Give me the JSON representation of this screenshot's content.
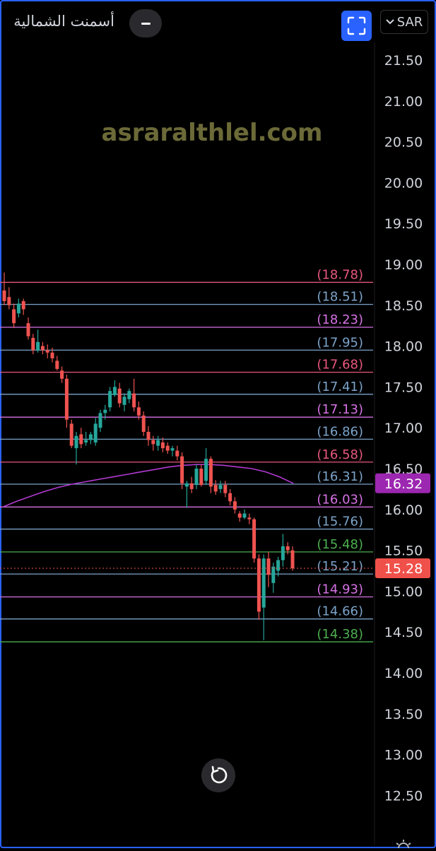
{
  "header": {
    "symbol_name": "أسمنت الشمالية",
    "currency": "SAR"
  },
  "watermark": "asraralthlel.com",
  "colors": {
    "accent": "#2962ff",
    "up_candle": "#26a69a",
    "down_candle": "#ef5350",
    "ma_line": "#b13ad1",
    "last_price_bg": "#f0504a",
    "ma_label_bg": "#9c27b0"
  },
  "chart_data": {
    "type": "candlestick",
    "y_axis_ticks": [
      "21.50",
      "21.00",
      "20.50",
      "20.00",
      "19.50",
      "19.00",
      "18.50",
      "18.00",
      "17.50",
      "17.00",
      "16.50",
      "16.00",
      "15.50",
      "15.00",
      "14.50",
      "14.00",
      "13.50",
      "13.00",
      "12.50"
    ],
    "ylim": [
      12.25,
      21.8
    ],
    "last_price": "15.28",
    "ma_value": "16.32",
    "levels": [
      {
        "label": "(18.78)",
        "value": 18.78,
        "color": "#e8577d"
      },
      {
        "label": "(18.51)",
        "value": 18.51,
        "color": "#7ba3c9"
      },
      {
        "label": "(18.23)",
        "value": 18.23,
        "color": "#d572e3"
      },
      {
        "label": "(17.95)",
        "value": 17.95,
        "color": "#7ba3c9"
      },
      {
        "label": "(17.68)",
        "value": 17.68,
        "color": "#e8577d"
      },
      {
        "label": "(17.41)",
        "value": 17.41,
        "color": "#7ba3c9"
      },
      {
        "label": "(17.13)",
        "value": 17.13,
        "color": "#d572e3"
      },
      {
        "label": "(16.86)",
        "value": 16.86,
        "color": "#7ba3c9"
      },
      {
        "label": "(16.58)",
        "value": 16.58,
        "color": "#e8577d"
      },
      {
        "label": "(16.31)",
        "value": 16.31,
        "color": "#7ba3c9"
      },
      {
        "label": "(16.03)",
        "value": 16.03,
        "color": "#d572e3"
      },
      {
        "label": "(15.76)",
        "value": 15.76,
        "color": "#7ba3c9"
      },
      {
        "label": "(15.48)",
        "value": 15.48,
        "color": "#4caf50"
      },
      {
        "label": "(15.21)",
        "value": 15.21,
        "color": "#7ba3c9"
      },
      {
        "label": "(14.93)",
        "value": 14.93,
        "color": "#d572e3"
      },
      {
        "label": "(14.66)",
        "value": 14.66,
        "color": "#7ba3c9"
      },
      {
        "label": "(14.38)",
        "value": 14.38,
        "color": "#4caf50"
      }
    ],
    "candles": [
      [
        18.68,
        18.9,
        18.5,
        18.55
      ],
      [
        18.6,
        18.72,
        18.45,
        18.5
      ],
      [
        18.45,
        18.52,
        18.22,
        18.28
      ],
      [
        18.4,
        18.58,
        18.35,
        18.52
      ],
      [
        18.55,
        18.58,
        18.38,
        18.45
      ],
      [
        18.28,
        18.35,
        18.08,
        18.12
      ],
      [
        18.1,
        18.15,
        17.9,
        17.95
      ],
      [
        17.95,
        18.2,
        17.92,
        18.05
      ],
      [
        18.0,
        18.05,
        17.9,
        17.95
      ],
      [
        17.95,
        18.02,
        17.85,
        17.92
      ],
      [
        17.92,
        17.98,
        17.8,
        17.85
      ],
      [
        17.82,
        17.88,
        17.7,
        17.72
      ],
      [
        17.7,
        17.75,
        17.55,
        17.6
      ],
      [
        17.6,
        17.65,
        17.0,
        17.1
      ],
      [
        17.05,
        17.1,
        16.75,
        16.78
      ],
      [
        16.75,
        16.95,
        16.55,
        16.9
      ],
      [
        16.92,
        17.0,
        16.75,
        16.8
      ],
      [
        16.82,
        16.95,
        16.78,
        16.85
      ],
      [
        16.85,
        16.95,
        16.8,
        16.92
      ],
      [
        16.82,
        17.12,
        16.78,
        17.05
      ],
      [
        17.0,
        17.22,
        16.95,
        17.18
      ],
      [
        17.18,
        17.28,
        17.1,
        17.22
      ],
      [
        17.25,
        17.5,
        17.2,
        17.45
      ],
      [
        17.4,
        17.58,
        17.38,
        17.5
      ],
      [
        17.48,
        17.55,
        17.25,
        17.3
      ],
      [
        17.28,
        17.42,
        17.2,
        17.38
      ],
      [
        17.35,
        17.48,
        17.3,
        17.45
      ],
      [
        17.42,
        17.6,
        17.2,
        17.25
      ],
      [
        17.25,
        17.32,
        17.1,
        17.15
      ],
      [
        17.15,
        17.2,
        16.9,
        16.95
      ],
      [
        16.95,
        17.02,
        16.78,
        16.85
      ],
      [
        16.85,
        16.9,
        16.72,
        16.8
      ],
      [
        16.78,
        16.9,
        16.72,
        16.85
      ],
      [
        16.82,
        16.88,
        16.7,
        16.75
      ],
      [
        16.78,
        16.82,
        16.68,
        16.72
      ],
      [
        16.72,
        16.78,
        16.65,
        16.75
      ],
      [
        16.72,
        16.78,
        16.6,
        16.65
      ],
      [
        16.65,
        16.7,
        16.25,
        16.32
      ],
      [
        16.28,
        16.35,
        16.02,
        16.32
      ],
      [
        16.32,
        16.4,
        16.2,
        16.25
      ],
      [
        16.3,
        16.55,
        16.25,
        16.5
      ],
      [
        16.5,
        16.55,
        16.28,
        16.3
      ],
      [
        16.35,
        16.75,
        16.3,
        16.62
      ],
      [
        16.62,
        16.65,
        16.2,
        16.28
      ],
      [
        16.3,
        16.36,
        16.18,
        16.22
      ],
      [
        16.25,
        16.35,
        16.2,
        16.3
      ],
      [
        16.3,
        16.35,
        16.15,
        16.2
      ],
      [
        16.2,
        16.25,
        16.05,
        16.1
      ],
      [
        16.1,
        16.15,
        15.95,
        16.0
      ],
      [
        15.95,
        15.98,
        15.85,
        15.9
      ],
      [
        15.9,
        16.0,
        15.88,
        15.95
      ],
      [
        15.9,
        15.95,
        15.82,
        15.88
      ],
      [
        15.88,
        15.9,
        15.35,
        15.4
      ],
      [
        15.4,
        15.45,
        14.65,
        14.75
      ],
      [
        14.8,
        15.45,
        14.4,
        15.4
      ],
      [
        15.4,
        15.48,
        15.05,
        15.2
      ],
      [
        15.1,
        15.35,
        14.98,
        15.3
      ],
      [
        15.25,
        15.42,
        15.18,
        15.38
      ],
      [
        15.38,
        15.7,
        15.3,
        15.55
      ],
      [
        15.55,
        15.6,
        15.45,
        15.5
      ],
      [
        15.5,
        15.55,
        15.25,
        15.28
      ]
    ],
    "ma": [
      16.03,
      16.1,
      16.16,
      16.22,
      16.27,
      16.31,
      16.34,
      16.37,
      16.4,
      16.43,
      16.46,
      16.49,
      16.52,
      16.54,
      16.55,
      16.55,
      16.54,
      16.52,
      16.5,
      16.46,
      16.4,
      16.32
    ]
  }
}
